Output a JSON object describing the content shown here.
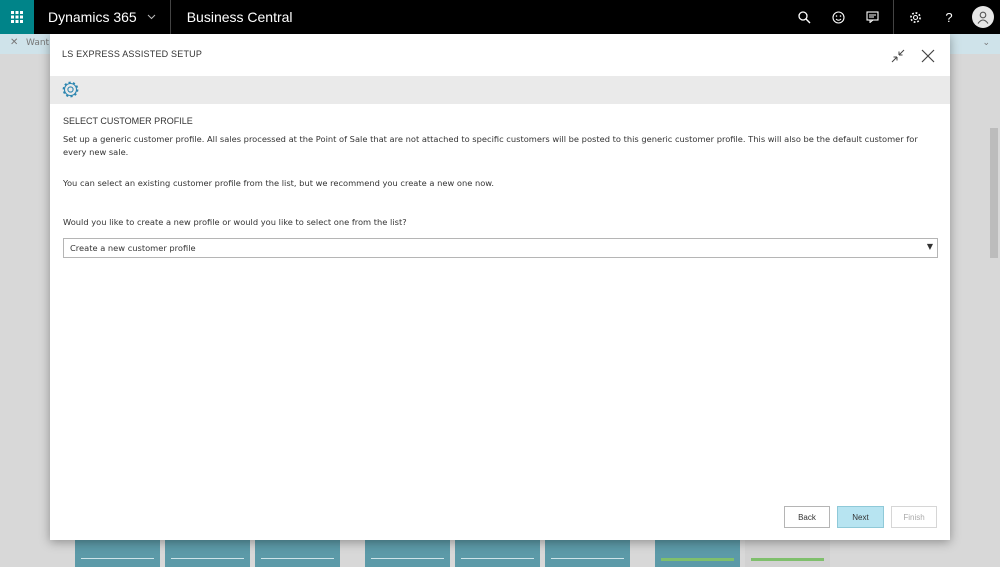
{
  "topbar": {
    "product": "Dynamics 365",
    "app_name": "Business Central",
    "help_label": "?"
  },
  "background": {
    "notice_text": "Want"
  },
  "dialog": {
    "title": "LS EXPRESS ASSISTED SETUP",
    "section_title": "SELECT CUSTOMER PROFILE",
    "description": "Set up a generic customer profile. All sales processed at the Point of Sale that are not attached to specific customers will be posted to this generic customer profile. This will also be the default customer for every new sale.",
    "recommendation": "You can select an existing customer profile from the list, but we recommend you create a new one now.",
    "question": "Would you like to create a new profile or would you like to select one from the list?",
    "profile_select": {
      "value": "Create a new customer profile"
    },
    "buttons": {
      "back": "Back",
      "next": "Next",
      "finish": "Finish"
    }
  },
  "colors": {
    "accent": "#008489",
    "primary_button": "#b7e4f1",
    "band": "#eaeaea"
  },
  "icons": [
    "waffle-icon",
    "search-icon",
    "smiley-icon",
    "chat-icon",
    "settings-icon",
    "help-icon",
    "user-icon",
    "collapse-icon",
    "close-icon",
    "gear-icon",
    "dropdown-arrow-icon"
  ]
}
